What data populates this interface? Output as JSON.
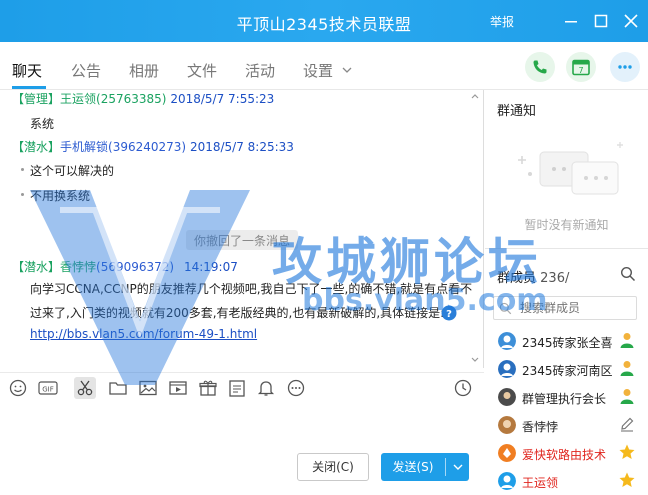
{
  "window": {
    "title": "平顶山2345技术员联盟",
    "report": "举报"
  },
  "tabs": [
    {
      "label": "聊天",
      "active": true
    },
    {
      "label": "公告"
    },
    {
      "label": "相册"
    },
    {
      "label": "文件"
    },
    {
      "label": "活动"
    },
    {
      "label": "设置"
    }
  ],
  "calendar_day": "7",
  "messages": [
    {
      "role": "【管理】",
      "name": "王运领",
      "id": "(25763385)",
      "time": "2018/5/7 7:55:23",
      "lines": [
        "系统"
      ]
    },
    {
      "role": "【潜水】",
      "name": "手机解锁",
      "id": "(396240273)",
      "time": "2018/5/7 8:25:33",
      "lines": [
        "这个可以解决的",
        "不用换系统"
      ]
    },
    {
      "recall": "你撤回了一条消息"
    },
    {
      "role": "【潜水】",
      "name": "香悖悖",
      "id": "(569096372)",
      "time": "14:19:07",
      "lines": [
        "向学习CCNA,CCNP的朋友推荐几个视频吧,我自己下了一些,的确不错,就是有点看不",
        "过来了,入门类的视频就有200多套,有老版经典的,也有最新破解的,具体链接是:",
        "http://bbs.vlan5.com/forum-49-1.html"
      ]
    }
  ],
  "buttons": {
    "close": "关闭(C)",
    "send": "发送(S)"
  },
  "notice": {
    "title": "群通知",
    "empty": "暂时没有新通知"
  },
  "members": {
    "title": "群成员",
    "count": "236/",
    "search_placeholder": "搜索群成员",
    "list": [
      {
        "name": "2345砖家张全喜",
        "color": "normal",
        "badge": "admin"
      },
      {
        "name": "2345砖家河南区",
        "color": "normal",
        "badge": "admin"
      },
      {
        "name": "群管理执行会长",
        "color": "normal",
        "badge": "admin"
      },
      {
        "name": "香悖悖",
        "color": "normal",
        "badge": "edit"
      },
      {
        "name": "爱快软路由技术",
        "color": "red",
        "badge": "owner"
      },
      {
        "name": "王运领",
        "color": "red",
        "badge": "owner"
      }
    ]
  },
  "watermark": {
    "text": "攻城狮论坛",
    "url": "bbs.vlan5.com"
  },
  "colors": {
    "titlebar": "#1e9ee8",
    "accent": "#1e9ee8",
    "role_green": "#1aa260",
    "time_blue": "#1c4fc4",
    "red_name": "#e0251e"
  }
}
